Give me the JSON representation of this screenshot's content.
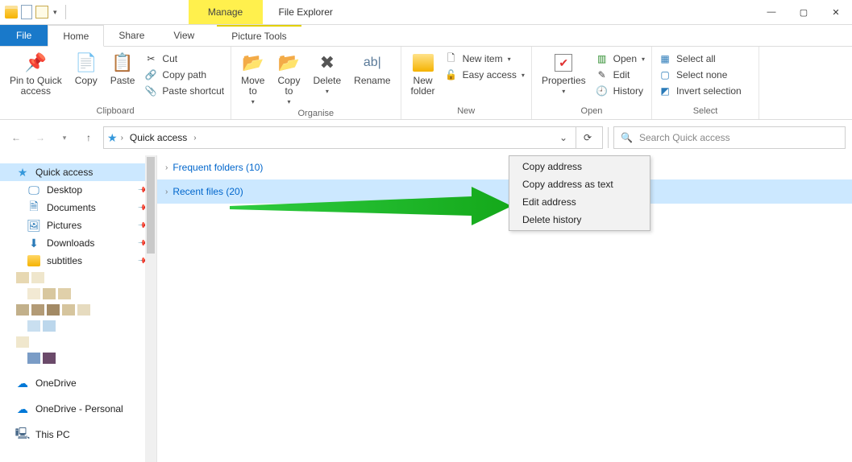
{
  "titlebar": {
    "contextual_tab": "Manage",
    "app_title": "File Explorer"
  },
  "tabs": {
    "file": "File",
    "home": "Home",
    "share": "Share",
    "view": "View",
    "picture_tools": "Picture Tools"
  },
  "ribbon": {
    "clipboard": {
      "pin": "Pin to Quick\naccess",
      "copy": "Copy",
      "paste": "Paste",
      "cut": "Cut",
      "copy_path": "Copy path",
      "paste_shortcut": "Paste shortcut",
      "group_label": "Clipboard"
    },
    "organise": {
      "move_to": "Move\nto",
      "copy_to": "Copy\nto",
      "delete": "Delete",
      "rename": "Rename",
      "group_label": "Organise"
    },
    "new": {
      "new_folder": "New\nfolder",
      "new_item": "New item",
      "easy_access": "Easy access",
      "group_label": "New"
    },
    "open": {
      "properties": "Properties",
      "open": "Open",
      "edit": "Edit",
      "history": "History",
      "group_label": "Open"
    },
    "select": {
      "select_all": "Select all",
      "select_none": "Select none",
      "invert": "Invert selection",
      "group_label": "Select"
    }
  },
  "nav": {
    "breadcrumb": "Quick access",
    "search_placeholder": "Search Quick access"
  },
  "navpane": {
    "quick_access": "Quick access",
    "items": [
      {
        "label": "Desktop"
      },
      {
        "label": "Documents"
      },
      {
        "label": "Pictures"
      },
      {
        "label": "Downloads"
      },
      {
        "label": "subtitles"
      }
    ],
    "onedrive": "OneDrive",
    "onedrive_personal": "OneDrive - Personal",
    "this_pc": "This PC"
  },
  "content": {
    "frequent": "Frequent folders (10)",
    "recent": "Recent files (20)"
  },
  "context_menu": {
    "items": [
      "Copy address",
      "Copy address as text",
      "Edit address",
      "Delete history"
    ]
  }
}
